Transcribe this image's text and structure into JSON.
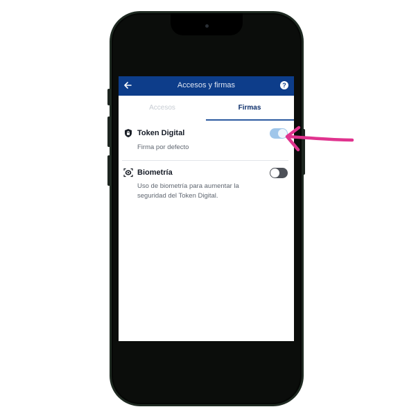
{
  "colors": {
    "header_bg": "#0d3d8a",
    "active_tab": "#0d2f6b",
    "inactive_tab": "#c7ccd3",
    "toggle_on": "#9fc6ea",
    "toggle_off": "#4d5158",
    "annotation_arrow": "#e0338e"
  },
  "header": {
    "back_icon": "arrow-left-icon",
    "title": "Accesos y firmas",
    "help_icon": "question-circle-icon",
    "help_glyph": "?"
  },
  "tabs": [
    {
      "label": "Accesos",
      "active": false
    },
    {
      "label": "Firmas",
      "active": true
    }
  ],
  "settings": [
    {
      "icon": "shield-lock-icon",
      "title": "Token Digital",
      "description": "Firma por defecto",
      "enabled": true
    },
    {
      "icon": "face-scan-icon",
      "title": "Biometría",
      "description": "Uso de biometría para aumentar la seguridad del Token Digital.",
      "enabled": false
    }
  ],
  "annotation": {
    "icon": "pointer-arrow-icon",
    "target": "Token Digital toggle"
  }
}
